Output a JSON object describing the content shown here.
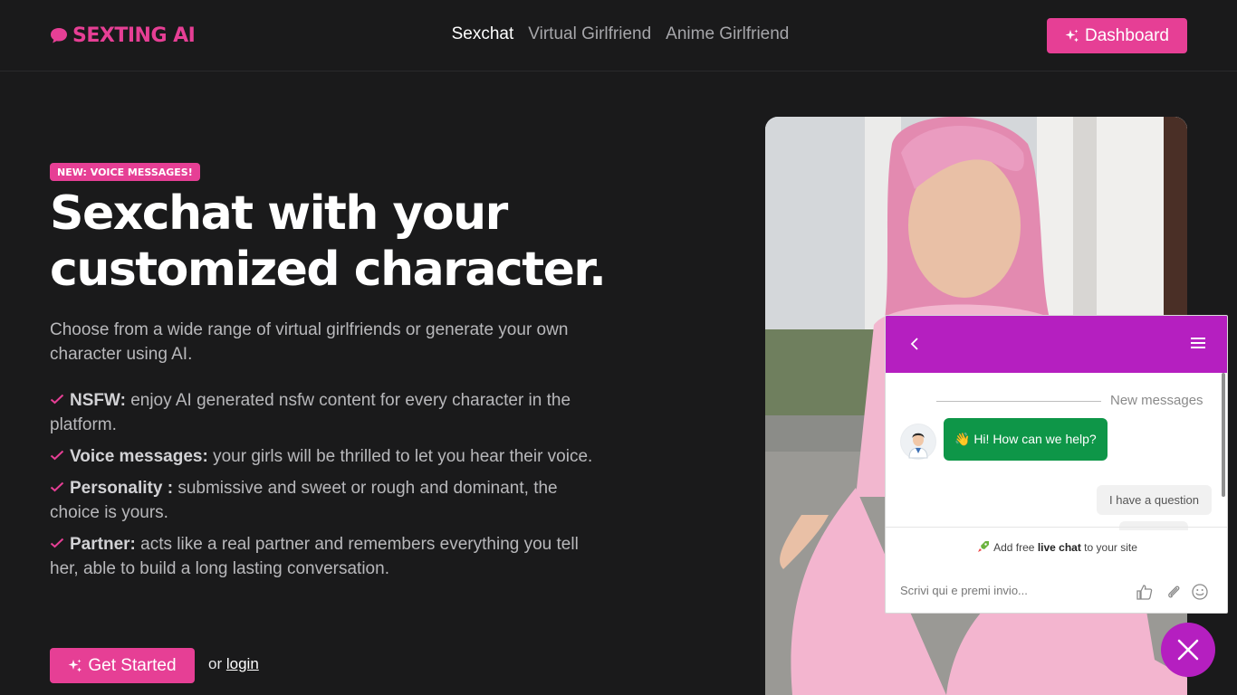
{
  "header": {
    "logo_text": "SEXTING AI",
    "nav": [
      {
        "label": "Sexchat",
        "active": true
      },
      {
        "label": "Virtual Girlfriend",
        "active": false
      },
      {
        "label": "Anime Girlfriend",
        "active": false
      }
    ],
    "dashboard_label": "Dashboard"
  },
  "hero": {
    "badge": "NEW: VOICE MESSAGES!",
    "headline_line1": "Sexchat with your",
    "headline_line2": "customized character.",
    "subtitle": "Choose from a wide range of virtual girlfriends or generate your own character using AI.",
    "features": [
      {
        "title": "NSFW:",
        "text": " enjoy AI generated nsfw content for every character in the platform."
      },
      {
        "title": "Voice messages:",
        "text": " your girls will be thrilled to let you hear their voice."
      },
      {
        "title": "Personality :",
        "text": " submissive and sweet or rough and dominant, the choice is yours."
      },
      {
        "title": "Partner:",
        "text": " acts like a real partner and remembers everything you tell her, able to build a long lasting conversation."
      }
    ],
    "cta_label": "Get Started",
    "or_text": "or",
    "login_label": "login"
  },
  "chat": {
    "new_messages": "New messages",
    "agent_message": "👋 Hi! How can we help?",
    "user_message": "I have a question",
    "promo_prefix": "Add free ",
    "promo_bold": "live chat",
    "promo_suffix": " to your site",
    "input_placeholder": "Scrivi qui e premi invio..."
  },
  "colors": {
    "background": "#1a1a1b",
    "accent_pink": "#e63f95",
    "chat_purple": "#b51fc0",
    "chat_green": "#0e9648"
  },
  "icons": [
    "chat-bubble-icon",
    "sparkle-icon",
    "check-icon",
    "chevron-left-icon",
    "hamburger-menu-icon",
    "thumbs-up-icon",
    "paperclip-icon",
    "emoji-icon",
    "close-icon"
  ]
}
